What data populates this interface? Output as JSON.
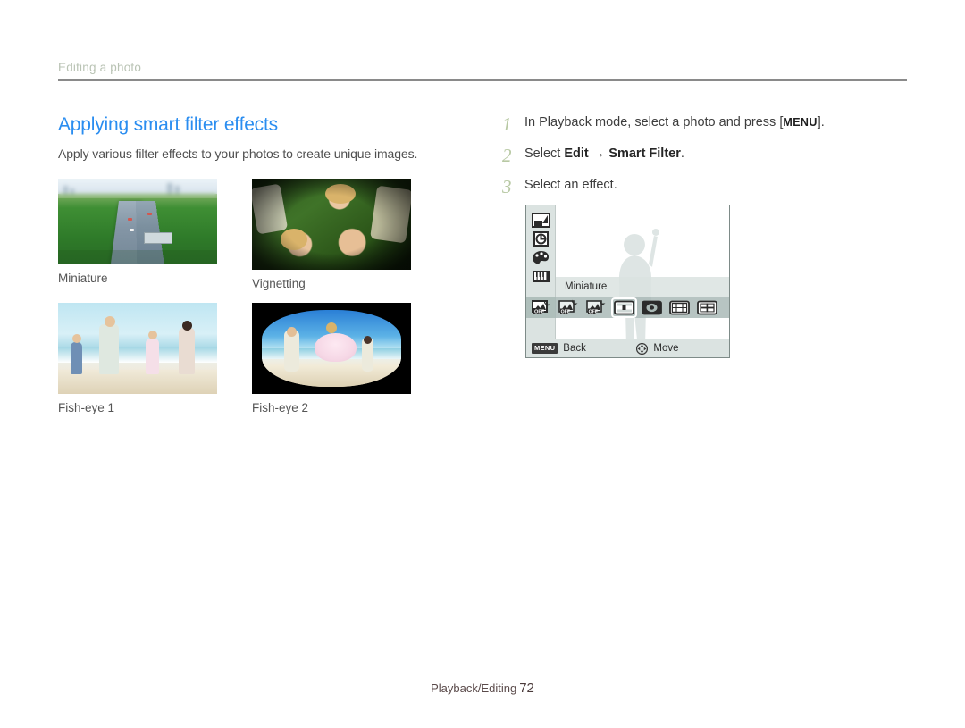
{
  "running_head": {
    "text": "Editing a photo"
  },
  "section": {
    "title": "Applying smart filter effects",
    "description": "Apply various filter effects to your photos to create unique images.",
    "title_color": "#2a8df0"
  },
  "samples": [
    {
      "caption": "Miniature",
      "art": "miniature"
    },
    {
      "caption": "Vignetting",
      "art": "vignetting"
    },
    {
      "caption": "Fish-eye 1",
      "art": "fisheye1"
    },
    {
      "caption": "Fish-eye 2",
      "art": "fisheye2"
    }
  ],
  "steps": [
    {
      "num": "1",
      "before": "In Playback mode, select a photo and press [",
      "key": "MENU",
      "after": "]."
    },
    {
      "num": "2",
      "before": "Select ",
      "bold1": "Edit",
      "arrow": " → ",
      "bold2": "Smart Filter",
      "after": "."
    },
    {
      "num": "3",
      "before": "Select an effect.",
      "key": "",
      "after": ""
    }
  ],
  "step_num_color": "#b8c9a4",
  "lcd": {
    "sidebar_icons": [
      {
        "name": "resize-icon"
      },
      {
        "name": "rotate-icon"
      },
      {
        "name": "palette-icon"
      },
      {
        "name": "smart-filter-icon"
      },
      {
        "name": "smart-filter-selected-icon"
      }
    ],
    "current_option_label": "Miniature",
    "effect_items": [
      {
        "name": "filter-off-1-icon",
        "selected": false
      },
      {
        "name": "filter-off-2-icon",
        "selected": false
      },
      {
        "name": "miniature-icon",
        "selected": true
      },
      {
        "name": "vignetting-icon",
        "selected": false
      },
      {
        "name": "fish-eye-1-icon",
        "selected": false
      },
      {
        "name": "fish-eye-2-icon",
        "selected": false
      }
    ],
    "footer": {
      "menu_chip": "MENU",
      "back_label": "Back",
      "move_label": "Move"
    }
  },
  "footer": {
    "section_label": "Playback/Editing",
    "page_number": "72"
  }
}
